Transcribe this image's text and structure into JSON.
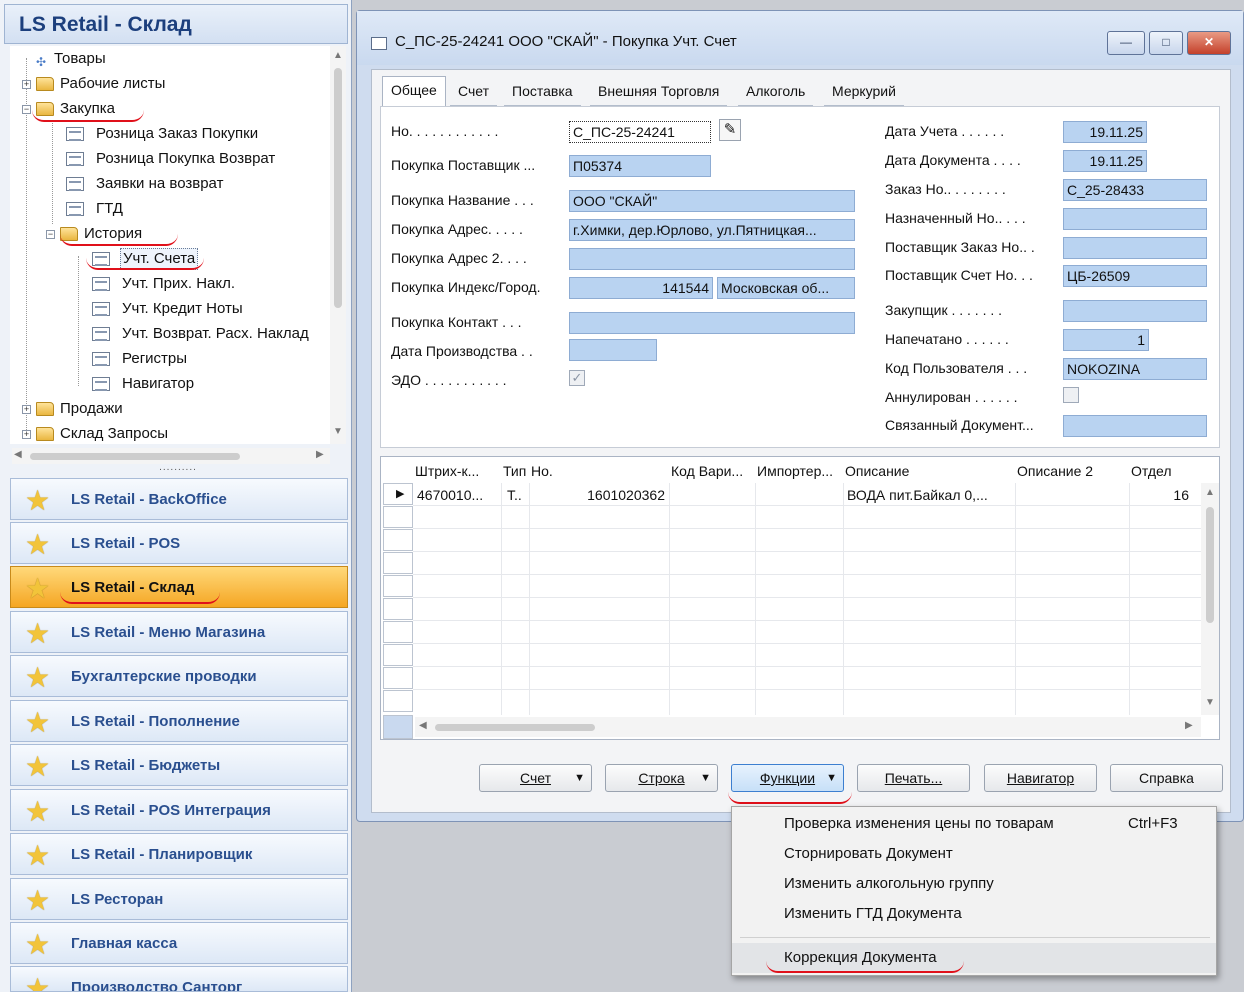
{
  "nav": {
    "title": "LS Retail - Склад",
    "tree": [
      {
        "label": "Товары",
        "level": 1
      },
      {
        "label": "Рабочие листы",
        "level": 0
      },
      {
        "label": "Закупка",
        "level": 0
      },
      {
        "label": "Розница Заказ Покупки",
        "level": 2
      },
      {
        "label": "Розница Покупка Возврат",
        "level": 2
      },
      {
        "label": "Заявки на возврат",
        "level": 2
      },
      {
        "label": "ГТД",
        "level": 2
      },
      {
        "label": "История",
        "level": 1
      },
      {
        "label": "Учт. Счета",
        "level": 3,
        "selected": true
      },
      {
        "label": "Учт. Прих. Накл.",
        "level": 3
      },
      {
        "label": "Учт. Кредит Ноты",
        "level": 3
      },
      {
        "label": "Учт. Возврат. Расх. Наклад",
        "level": 3
      },
      {
        "label": "Регистры",
        "level": 3
      },
      {
        "label": "Навигатор",
        "level": 3
      },
      {
        "label": "Продажи",
        "level": 0
      },
      {
        "label": "Склад Запросы",
        "level": 0
      }
    ],
    "splitter": "..........",
    "buttons": [
      "LS Retail - BackOffice",
      "LS Retail - POS",
      "LS Retail - Склад",
      "LS Retail - Меню Магазина",
      "Бухгалтерские проводки",
      "LS Retail - Пополнение",
      "LS Retail - Бюджеты",
      "LS Retail - POS Интеграция",
      "LS Retail - Планировщик",
      "LS Ресторан",
      "Главная касса",
      "Производство Санторг"
    ]
  },
  "window": {
    "title": "С_ПС-25-24241 ООО \"СКАЙ\" - Покупка Учт. Счет",
    "controls": {
      "minimize": "—",
      "maximize": "□",
      "close": "✕"
    }
  },
  "tabs": [
    "Общее",
    "Счет",
    "Поставка",
    "Внешняя Торговля",
    "Алкоголь",
    "Меркурий"
  ],
  "left_fields": [
    {
      "label": "Но. . . . . . . . . . . .",
      "value": "С_ПС-25-24241"
    },
    {
      "label": "Покупка Поставщик ...",
      "value": "П05374"
    },
    {
      "label": "Покупка Название . . .",
      "value": "ООО \"СКАЙ\""
    },
    {
      "label": "Покупка Адрес. . . . .",
      "value": "г.Химки, дер.Юрлово, ул.Пятницкая..."
    },
    {
      "label": "Покупка Адрес 2. . . .",
      "value": ""
    },
    {
      "label": "Покупка Индекс/Город.",
      "value": "141544",
      "value2": "Московская об..."
    },
    {
      "label": "Покупка Контакт . . .",
      "value": ""
    },
    {
      "label": "Дата Производства . .",
      "value": ""
    },
    {
      "label": "ЭДО . . . . . . . . . . .",
      "checked": "✓"
    }
  ],
  "right_fields": [
    {
      "label": "Дата Учета . . . . . .",
      "value": "19.11.25"
    },
    {
      "label": "Дата Документа . . . .",
      "value": "19.11.25"
    },
    {
      "label": "Заказ Но.. . . . . . . .",
      "value": "С_25-28433"
    },
    {
      "label": "Назначенный Но.. . . .",
      "value": ""
    },
    {
      "label": "Поставщик Заказ Но.. .",
      "value": ""
    },
    {
      "label": "Поставщик Счет Но. . .",
      "value": "ЦБ-26509"
    },
    {
      "label": "Закупщик . . . . . . .",
      "value": ""
    },
    {
      "label": "Напечатано . . . . . .",
      "value": "1"
    },
    {
      "label": "Код Пользователя . . .",
      "value": "NOKOZINA"
    },
    {
      "label": "Аннулирован . . . . . .",
      "checked": ""
    },
    {
      "label": "Связанный Документ...",
      "value": ""
    }
  ],
  "grid": {
    "columns": [
      "Штрих-к...",
      "Тип",
      "Но.",
      "Код Вари...",
      "Импортер...",
      "Описание",
      "Описание 2",
      "Отдел"
    ],
    "rows": [
      [
        "4670010...",
        "Т..",
        "1601020362",
        "",
        "",
        "ВОДА пит.Байкал 0,...",
        "",
        "16"
      ]
    ],
    "current_row_marker": "▶"
  },
  "buttons": [
    {
      "label": "Счет",
      "dropdown": "▼"
    },
    {
      "label": "Строка",
      "dropdown": "▼"
    },
    {
      "label": "Функции",
      "dropdown": "▼"
    },
    {
      "label": "Печать..."
    },
    {
      "label": "Навигатор"
    },
    {
      "label": "Справка"
    }
  ],
  "menu": [
    {
      "label": "Проверка изменения цены по товарам",
      "shortcut": "Ctrl+F3"
    },
    {
      "label": "Сторнировать Документ",
      "shortcut": ""
    },
    {
      "label": "Изменить алкогольную группу",
      "shortcut": ""
    },
    {
      "label": "Изменить ГТД Документа",
      "shortcut": ""
    },
    {
      "label": "Коррекция Документа",
      "shortcut": ""
    }
  ],
  "icons": {
    "star": "★",
    "edit": "✎",
    "tree_plus": "+",
    "tree_minus": "−",
    "scroll_up": "▲",
    "scroll_down": "▼",
    "scroll_left": "◀",
    "scroll_right": "▶"
  },
  "colors": {
    "field_bg": "#b9d3f1",
    "active_nav": "#f5a623",
    "annotation": "#e0101a"
  }
}
